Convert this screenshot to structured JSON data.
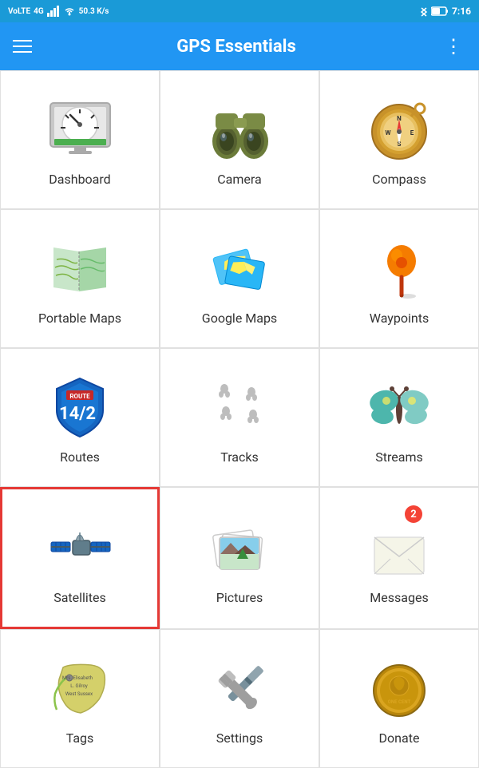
{
  "statusBar": {
    "carrier": "VoLTE 4G",
    "signal": "4G",
    "speed": "50.3 K/s",
    "bluetooth": "BT",
    "battery": "54",
    "time": "7:16"
  },
  "toolbar": {
    "title": "GPS Essentials",
    "menuIcon": "menu-icon",
    "moreIcon": "more-icon"
  },
  "grid": {
    "items": [
      {
        "id": "dashboard",
        "label": "Dashboard",
        "icon": "dashboard-icon",
        "selected": false,
        "badge": 0
      },
      {
        "id": "camera",
        "label": "Camera",
        "icon": "camera-icon",
        "selected": false,
        "badge": 0
      },
      {
        "id": "compass",
        "label": "Compass",
        "icon": "compass-icon",
        "selected": false,
        "badge": 0
      },
      {
        "id": "portable-maps",
        "label": "Portable Maps",
        "icon": "portable-maps-icon",
        "selected": false,
        "badge": 0
      },
      {
        "id": "google-maps",
        "label": "Google Maps",
        "icon": "google-maps-icon",
        "selected": false,
        "badge": 0
      },
      {
        "id": "waypoints",
        "label": "Waypoints",
        "icon": "waypoints-icon",
        "selected": false,
        "badge": 0
      },
      {
        "id": "routes",
        "label": "Routes",
        "icon": "routes-icon",
        "selected": false,
        "badge": 0
      },
      {
        "id": "tracks",
        "label": "Tracks",
        "icon": "tracks-icon",
        "selected": false,
        "badge": 0
      },
      {
        "id": "streams",
        "label": "Streams",
        "icon": "streams-icon",
        "selected": false,
        "badge": 0
      },
      {
        "id": "satellites",
        "label": "Satellites",
        "icon": "satellites-icon",
        "selected": true,
        "badge": 0
      },
      {
        "id": "pictures",
        "label": "Pictures",
        "icon": "pictures-icon",
        "selected": false,
        "badge": 0
      },
      {
        "id": "messages",
        "label": "Messages",
        "icon": "messages-icon",
        "selected": false,
        "badge": 2
      },
      {
        "id": "tags",
        "label": "Tags",
        "icon": "tags-icon",
        "selected": false,
        "badge": 0
      },
      {
        "id": "settings",
        "label": "Settings",
        "icon": "settings-icon",
        "selected": false,
        "badge": 0
      },
      {
        "id": "donate",
        "label": "Donate",
        "icon": "donate-icon",
        "selected": false,
        "badge": 0
      }
    ]
  }
}
